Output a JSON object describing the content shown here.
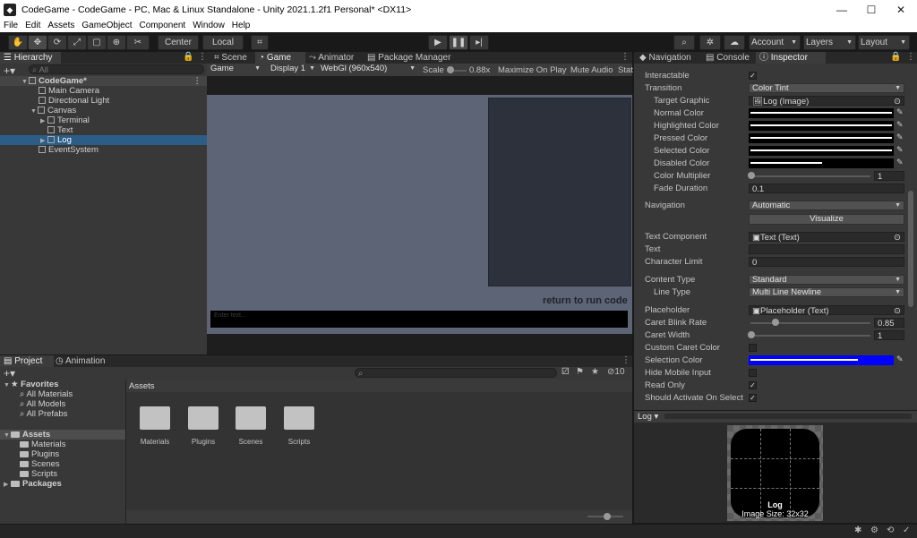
{
  "window": {
    "title": "CodeGame - CodeGame - PC, Mac & Linux Standalone - Unity 2021.1.2f1 Personal* <DX11>",
    "minimize": "—",
    "maximize": "☐",
    "close": "✕"
  },
  "menu": [
    "File",
    "Edit",
    "Assets",
    "GameObject",
    "Component",
    "Window",
    "Help"
  ],
  "toolbar": {
    "pivot_center": "Center",
    "pivot_local": "Local",
    "account": "Account",
    "layers": "Layers",
    "layout": "Layout"
  },
  "hierarchy": {
    "tab": "Hierarchy",
    "search_placeholder": "All",
    "items": [
      {
        "label": "CodeGame*",
        "depth": 0
      },
      {
        "label": "Main Camera",
        "depth": 1
      },
      {
        "label": "Directional Light",
        "depth": 1
      },
      {
        "label": "Canvas",
        "depth": 1
      },
      {
        "label": "Terminal",
        "depth": 2
      },
      {
        "label": "Text",
        "depth": 2
      },
      {
        "label": "Log",
        "depth": 2
      },
      {
        "label": "EventSystem",
        "depth": 1
      }
    ]
  },
  "center_tabs": [
    "Scene",
    "Game",
    "Animator",
    "Package Manager"
  ],
  "game_toolbar": {
    "display_mode": "Game",
    "display": "Display 1",
    "resolution": "WebGl (960x540)",
    "scale_label": "Scale",
    "scale_value": "0.88x",
    "maximize": "Maximize On Play",
    "mute": "Mute Audio",
    "stats": "Stat"
  },
  "game_view": {
    "hint": "return to run code",
    "input_placeholder": "Enter text..."
  },
  "bottom_tabs": [
    "Project",
    "Animation"
  ],
  "project": {
    "count": "10",
    "tree": {
      "favorites": "Favorites",
      "favorite_items": [
        "All Materials",
        "All Models",
        "All Prefabs"
      ],
      "assets": "Assets",
      "asset_items": [
        "Materials",
        "Plugins",
        "Scenes",
        "Scripts"
      ],
      "packages": "Packages"
    },
    "breadcrumb": "Assets",
    "folders": [
      "Materials",
      "Plugins",
      "Scenes",
      "Scripts"
    ]
  },
  "inspector_tabs": [
    "Navigation",
    "Console",
    "Inspector"
  ],
  "inspector": {
    "interactable": "Interactable",
    "transition_label": "Transition",
    "transition_value": "Color Tint",
    "target_graphic_label": "Target Graphic",
    "target_graphic_value": "Log (Image)",
    "normal_color": "Normal Color",
    "highlighted_color": "Highlighted Color",
    "pressed_color": "Pressed Color",
    "selected_color": "Selected Color",
    "disabled_color": "Disabled Color",
    "color_multiplier_label": "Color Multiplier",
    "color_multiplier_value": "1",
    "fade_duration_label": "Fade Duration",
    "fade_duration_value": "0.1",
    "navigation_label": "Navigation",
    "navigation_value": "Automatic",
    "visualize": "Visualize",
    "text_component_label": "Text Component",
    "text_component_value": "Text (Text)",
    "text_label": "Text",
    "text_value": "",
    "char_limit_label": "Character Limit",
    "char_limit_value": "0",
    "content_type_label": "Content Type",
    "content_type_value": "Standard",
    "line_type_label": "Line Type",
    "line_type_value": "Multi Line Newline",
    "placeholder_label": "Placeholder",
    "placeholder_value": "Placeholder (Text)",
    "caret_blink_label": "Caret Blink Rate",
    "caret_blink_value": "0.85",
    "caret_blink_level": 0.2,
    "caret_width_label": "Caret Width",
    "caret_width_value": "1",
    "custom_caret_label": "Custom Caret Color",
    "selection_color_label": "Selection Color",
    "hide_mobile_label": "Hide Mobile Input",
    "read_only_label": "Read Only",
    "activate_on_select_label": "Should Activate On Select"
  },
  "preview": {
    "title": "Log",
    "name": "Log",
    "size": "Image Size: 32x32"
  },
  "colors": {
    "accent_blue": "#2c5d87",
    "selection_color": "#0000ff",
    "game_bg": "#5d6475",
    "terminal_panel": "#2d313b"
  }
}
